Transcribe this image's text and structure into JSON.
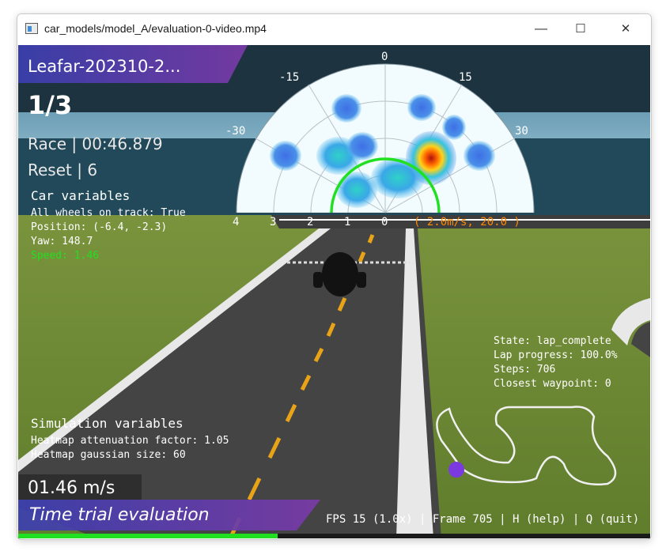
{
  "window": {
    "title": "car_models/model_A/evaluation-0-video.mp4",
    "minimize_glyph": "—",
    "maximize_glyph": "☐",
    "close_glyph": "✕"
  },
  "hud": {
    "racer_name": "Leafar-202310-2...",
    "lap": "1/3",
    "race_time": "Race | 00:46.879",
    "reset_count": "Reset | 6",
    "speed_display": "01.46 m/s",
    "mode": "Time trial evaluation",
    "progress_fraction": 0.41
  },
  "car_variables": {
    "header": "Car variables",
    "wheels": "All wheels on track: True",
    "position": "Position: (-6.4, -2.3)",
    "yaw": "Yaw: 148.7",
    "speed": "Speed: 1.46"
  },
  "sim_variables": {
    "header": "Simulation variables",
    "attenuation": "Heatmap attenuation factor: 1.05",
    "gaussian": "Heatmap gaussian size: 60"
  },
  "state_info": {
    "state": "State: lap_complete",
    "lap_progress": "Lap progress: 100.0%",
    "steps": "Steps: 706",
    "waypoint": "Closest waypoint: 0"
  },
  "polar": {
    "angle_labels": [
      "0",
      "-15",
      "15",
      "-30",
      "30"
    ],
    "radius_labels": [
      "4",
      "3",
      "2",
      "1",
      "0"
    ],
    "action_label": "( 2.0m/s, 20.0 )"
  },
  "footer": {
    "status": "FPS 15 (1.0x) | Frame 705 | H (help) | Q (quit)"
  },
  "colors": {
    "accent_green": "#21e021",
    "banner_purple": "#5b2d8f",
    "banner_blue": "#4a3ab8",
    "sky": "#8fc1d8",
    "grass": "#6e8a36",
    "asphalt": "#4a4a4a",
    "center_line": "#e8a317",
    "action_orange": "#ff8a00"
  }
}
